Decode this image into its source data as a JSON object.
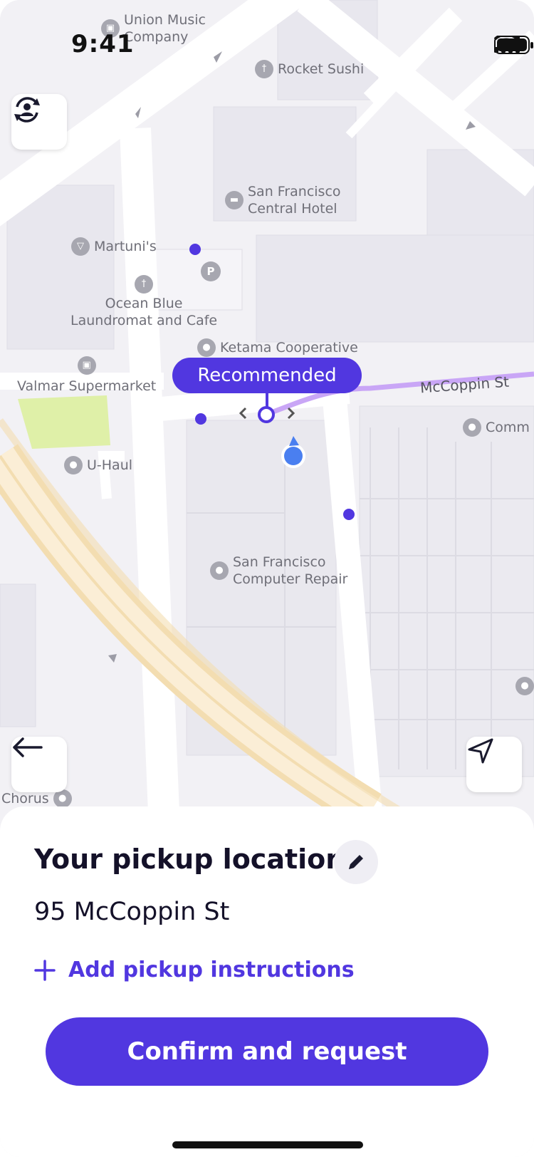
{
  "status_bar": {
    "time": "9:41"
  },
  "map": {
    "pois": [
      {
        "id": "union-music",
        "label": "Union Music\nCompany",
        "icon": "shopping-bag-icon"
      },
      {
        "id": "rocket-sushi",
        "label": "Rocket Sushi",
        "icon": "fork-knife-icon"
      },
      {
        "id": "sf-central-hotel",
        "label": "San Francisco\nCentral Hotel",
        "icon": "bed-icon"
      },
      {
        "id": "martunis",
        "label": "Martuni's",
        "icon": "cocktail-icon"
      },
      {
        "id": "parking",
        "label": "",
        "icon": "parking-icon"
      },
      {
        "id": "ocean-blue",
        "label": "Ocean Blue\nLaundromat and Cafe",
        "icon": "fork-knife-icon"
      },
      {
        "id": "ketama",
        "label": "Ketama Cooperative",
        "icon": "pin-icon"
      },
      {
        "id": "valmar",
        "label": "Valmar Supermarket",
        "icon": "shopping-bag-icon"
      },
      {
        "id": "uhaul",
        "label": "U-Haul",
        "icon": "pin-icon"
      },
      {
        "id": "comm",
        "label": "Comm",
        "icon": "pin-icon"
      },
      {
        "id": "sf-computer-repair",
        "label": "San Francisco\nComputer Repair",
        "icon": "pin-icon"
      },
      {
        "id": "chorus",
        "label": "Chorus",
        "icon": "pin-icon"
      }
    ],
    "street_label": "McCoppin St",
    "recommended_label": "Recommended",
    "accent_color": "#5137e0",
    "user_location_color": "#4a7ff0"
  },
  "sheet": {
    "title": "Your pickup location",
    "address": "95 McCoppin St",
    "add_instructions_label": "Add pickup instructions",
    "confirm_label": "Confirm and request"
  }
}
